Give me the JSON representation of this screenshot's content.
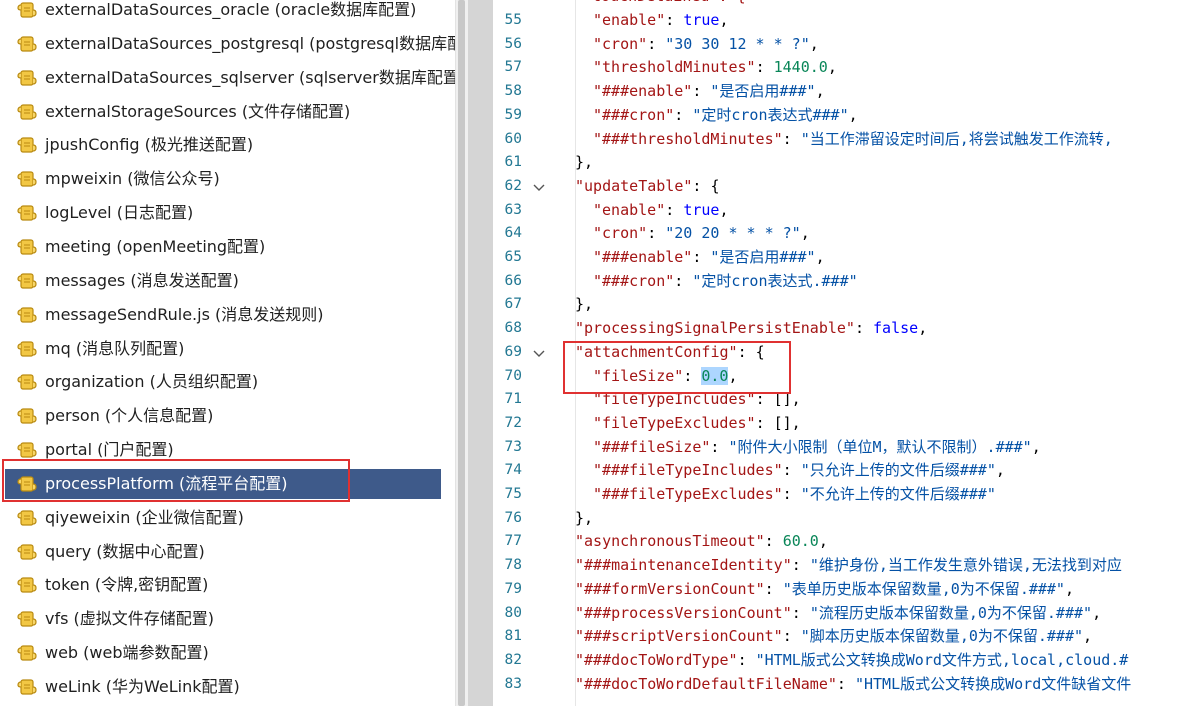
{
  "tree": {
    "items": [
      {
        "label": "externalDataSources_oracle (oracle数据库配置)",
        "selected": false
      },
      {
        "label": "externalDataSources_postgresql (postgresql数据库配",
        "selected": false
      },
      {
        "label": "externalDataSources_sqlserver (sqlserver数据库配置)",
        "selected": false
      },
      {
        "label": "externalStorageSources (文件存储配置)",
        "selected": false
      },
      {
        "label": "jpushConfig (极光推送配置)",
        "selected": false
      },
      {
        "label": "mpweixin (微信公众号)",
        "selected": false
      },
      {
        "label": "logLevel (日志配置)",
        "selected": false
      },
      {
        "label": "meeting (openMeeting配置)",
        "selected": false
      },
      {
        "label": "messages (消息发送配置)",
        "selected": false
      },
      {
        "label": "messageSendRule.js (消息发送规则)",
        "selected": false
      },
      {
        "label": "mq (消息队列配置)",
        "selected": false
      },
      {
        "label": "organization (人员组织配置)",
        "selected": false
      },
      {
        "label": "person (个人信息配置)",
        "selected": false
      },
      {
        "label": "portal (门户配置)",
        "selected": false
      },
      {
        "label": "processPlatform (流程平台配置)",
        "selected": true
      },
      {
        "label": "qiyeweixin (企业微信配置)",
        "selected": false
      },
      {
        "label": "query (数据中心配置)",
        "selected": false
      },
      {
        "label": "token (令牌,密钥配置)",
        "selected": false
      },
      {
        "label": "vfs (虚拟文件存储配置)",
        "selected": false
      },
      {
        "label": "web (web端参数配置)",
        "selected": false
      },
      {
        "label": "weLink (华为WeLink配置)",
        "selected": false
      }
    ]
  },
  "editor": {
    "partial_top_line": "\"touchDetained\": {",
    "lines": [
      {
        "n": "55",
        "fold": false,
        "indent": 2,
        "tokens": [
          [
            "k",
            "\"enable\""
          ],
          [
            "p",
            ": "
          ],
          [
            "b",
            "true"
          ],
          [
            "p",
            ","
          ]
        ]
      },
      {
        "n": "56",
        "fold": false,
        "indent": 2,
        "tokens": [
          [
            "k",
            "\"cron\""
          ],
          [
            "p",
            ": "
          ],
          [
            "s",
            "\"30 30 12 * * ?\""
          ],
          [
            "p",
            ","
          ]
        ]
      },
      {
        "n": "57",
        "fold": false,
        "indent": 2,
        "tokens": [
          [
            "k",
            "\"thresholdMinutes\""
          ],
          [
            "p",
            ": "
          ],
          [
            "n",
            "1440.0"
          ],
          [
            "p",
            ","
          ]
        ]
      },
      {
        "n": "58",
        "fold": false,
        "indent": 2,
        "tokens": [
          [
            "k",
            "\"###enable\""
          ],
          [
            "p",
            ": "
          ],
          [
            "s",
            "\"是否启用###\""
          ],
          [
            "p",
            ","
          ]
        ]
      },
      {
        "n": "59",
        "fold": false,
        "indent": 2,
        "tokens": [
          [
            "k",
            "\"###cron\""
          ],
          [
            "p",
            ": "
          ],
          [
            "s",
            "\"定时cron表达式###\""
          ],
          [
            "p",
            ","
          ]
        ]
      },
      {
        "n": "60",
        "fold": false,
        "indent": 2,
        "tokens": [
          [
            "k",
            "\"###thresholdMinutes\""
          ],
          [
            "p",
            ": "
          ],
          [
            "s",
            "\"当工作滞留设定时间后,将尝试触发工作流转,"
          ]
        ]
      },
      {
        "n": "61",
        "fold": false,
        "indent": 1,
        "tokens": [
          [
            "p",
            "},"
          ]
        ]
      },
      {
        "n": "62",
        "fold": true,
        "indent": 1,
        "tokens": [
          [
            "k",
            "\"updateTable\""
          ],
          [
            "p",
            ": {"
          ]
        ]
      },
      {
        "n": "63",
        "fold": false,
        "indent": 2,
        "tokens": [
          [
            "k",
            "\"enable\""
          ],
          [
            "p",
            ": "
          ],
          [
            "b",
            "true"
          ],
          [
            "p",
            ","
          ]
        ]
      },
      {
        "n": "64",
        "fold": false,
        "indent": 2,
        "tokens": [
          [
            "k",
            "\"cron\""
          ],
          [
            "p",
            ": "
          ],
          [
            "s",
            "\"20 20 * * * ?\""
          ],
          [
            "p",
            ","
          ]
        ]
      },
      {
        "n": "65",
        "fold": false,
        "indent": 2,
        "tokens": [
          [
            "k",
            "\"###enable\""
          ],
          [
            "p",
            ": "
          ],
          [
            "s",
            "\"是否启用###\""
          ],
          [
            "p",
            ","
          ]
        ]
      },
      {
        "n": "66",
        "fold": false,
        "indent": 2,
        "tokens": [
          [
            "k",
            "\"###cron\""
          ],
          [
            "p",
            ": "
          ],
          [
            "s",
            "\"定时cron表达式.###\""
          ]
        ]
      },
      {
        "n": "67",
        "fold": false,
        "indent": 1,
        "tokens": [
          [
            "p",
            "},"
          ]
        ]
      },
      {
        "n": "68",
        "fold": false,
        "indent": 1,
        "tokens": [
          [
            "k",
            "\"processingSignalPersistEnable\""
          ],
          [
            "p",
            ": "
          ],
          [
            "b",
            "false"
          ],
          [
            "p",
            ","
          ]
        ]
      },
      {
        "n": "69",
        "fold": true,
        "indent": 1,
        "tokens": [
          [
            "k",
            "\"attachmentConfig\""
          ],
          [
            "p",
            ": {"
          ]
        ]
      },
      {
        "n": "70",
        "fold": false,
        "indent": 2,
        "tokens": [
          [
            "k",
            "\"fileSize\""
          ],
          [
            "p",
            ": "
          ],
          [
            "c",
            ""
          ],
          [
            "nsel",
            "0.0"
          ],
          [
            "p",
            ","
          ]
        ]
      },
      {
        "n": "71",
        "fold": false,
        "indent": 2,
        "tokens": [
          [
            "k",
            "\"fileTypeIncludes\""
          ],
          [
            "p",
            ": [],"
          ]
        ]
      },
      {
        "n": "72",
        "fold": false,
        "indent": 2,
        "tokens": [
          [
            "k",
            "\"fileTypeExcludes\""
          ],
          [
            "p",
            ": [],"
          ]
        ]
      },
      {
        "n": "73",
        "fold": false,
        "indent": 2,
        "tokens": [
          [
            "k",
            "\"###fileSize\""
          ],
          [
            "p",
            ": "
          ],
          [
            "s",
            "\"附件大小限制（单位M，默认不限制）.###\""
          ],
          [
            "p",
            ","
          ]
        ]
      },
      {
        "n": "74",
        "fold": false,
        "indent": 2,
        "tokens": [
          [
            "k",
            "\"###fileTypeIncludes\""
          ],
          [
            "p",
            ": "
          ],
          [
            "s",
            "\"只允许上传的文件后缀###\""
          ],
          [
            "p",
            ","
          ]
        ]
      },
      {
        "n": "75",
        "fold": false,
        "indent": 2,
        "tokens": [
          [
            "k",
            "\"###fileTypeExcludes\""
          ],
          [
            "p",
            ": "
          ],
          [
            "s",
            "\"不允许上传的文件后缀###\""
          ]
        ]
      },
      {
        "n": "76",
        "fold": false,
        "indent": 1,
        "tokens": [
          [
            "p",
            "},"
          ]
        ]
      },
      {
        "n": "77",
        "fold": false,
        "indent": 1,
        "tokens": [
          [
            "k",
            "\"asynchronousTimeout\""
          ],
          [
            "p",
            ": "
          ],
          [
            "n",
            "60.0"
          ],
          [
            "p",
            ","
          ]
        ]
      },
      {
        "n": "78",
        "fold": false,
        "indent": 1,
        "tokens": [
          [
            "k",
            "\"###maintenanceIdentity\""
          ],
          [
            "p",
            ": "
          ],
          [
            "s",
            "\"维护身份,当工作发生意外错误,无法找到对应"
          ]
        ]
      },
      {
        "n": "79",
        "fold": false,
        "indent": 1,
        "tokens": [
          [
            "k",
            "\"###formVersionCount\""
          ],
          [
            "p",
            ": "
          ],
          [
            "s",
            "\"表单历史版本保留数量,0为不保留.###\""
          ],
          [
            "p",
            ","
          ]
        ]
      },
      {
        "n": "80",
        "fold": false,
        "indent": 1,
        "tokens": [
          [
            "k",
            "\"###processVersionCount\""
          ],
          [
            "p",
            ": "
          ],
          [
            "s",
            "\"流程历史版本保留数量,0为不保留.###\""
          ],
          [
            "p",
            ","
          ]
        ]
      },
      {
        "n": "81",
        "fold": false,
        "indent": 1,
        "tokens": [
          [
            "k",
            "\"###scriptVersionCount\""
          ],
          [
            "p",
            ": "
          ],
          [
            "s",
            "\"脚本历史版本保留数量,0为不保留.###\""
          ],
          [
            "p",
            ","
          ]
        ]
      },
      {
        "n": "82",
        "fold": false,
        "indent": 1,
        "tokens": [
          [
            "k",
            "\"###docToWordType\""
          ],
          [
            "p",
            ": "
          ],
          [
            "s",
            "\"HTML版式公文转换成Word文件方式,local,cloud.#"
          ]
        ]
      },
      {
        "n": "83",
        "fold": false,
        "indent": 1,
        "tokens": [
          [
            "k",
            "\"###docToWordDefaultFileName\""
          ],
          [
            "p",
            ": "
          ],
          [
            "s",
            "\"HTML版式公文转换成Word文件缺省文件"
          ]
        ]
      }
    ]
  },
  "colors": {
    "selection_row": "#3e5a8a",
    "highlight_box": "#e03131",
    "json_key": "#a31515",
    "json_string": "#0451a5",
    "json_number": "#098658",
    "json_bool": "#0000ff",
    "line_number": "#237893"
  }
}
